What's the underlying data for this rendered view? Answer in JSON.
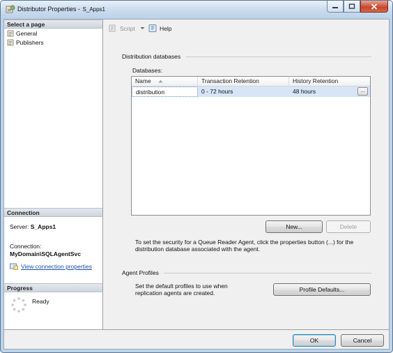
{
  "window": {
    "title": "Distributor Properties - ",
    "server_suffix": "S_Apps1"
  },
  "left_panel": {
    "select_page_header": "Select a page",
    "pages": [
      {
        "label": "General",
        "icon": "property-page-icon"
      },
      {
        "label": "Publishers",
        "icon": "property-page-icon"
      }
    ],
    "connection_header": "Connection",
    "server_label": "Server:",
    "server_value": "S_Apps1",
    "connection_label": "Connection:",
    "connection_value": "MyDomain\\SQLAgentSvc",
    "view_connection_link": "View connection properties",
    "progress_header": "Progress",
    "progress_status": "Ready"
  },
  "toolbar": {
    "script_label": "Script",
    "help_label": "Help"
  },
  "distribution_databases": {
    "group_title": "Distribution databases",
    "databases_label": "Databases:",
    "columns": [
      "Name",
      "Transaction Retention",
      "History Retention"
    ],
    "rows": [
      {
        "name": "distribution",
        "transaction_retention": "0 - 72 hours",
        "history_retention": "48 hours"
      }
    ],
    "ellipsis_label": "...",
    "new_button": "New...",
    "delete_button": "Delete",
    "security_note_line1": "To set the security for a Queue Reader Agent, click the properties button (...) for the",
    "security_note_line2": "distribution database associated with the agent."
  },
  "agent_profiles": {
    "group_title": "Agent Profiles",
    "description_line1": "Set the default profiles to use when",
    "description_line2": "replication agents are created.",
    "profile_defaults_button": "Profile Defaults..."
  },
  "footer": {
    "ok_button": "OK",
    "cancel_button": "Cancel"
  }
}
